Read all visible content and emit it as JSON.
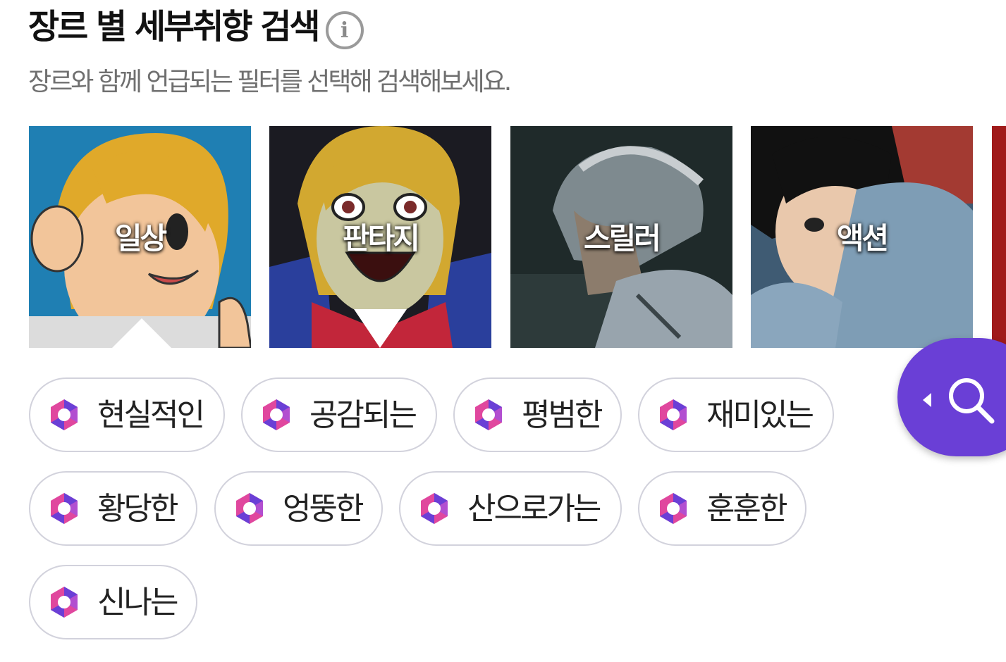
{
  "header": {
    "title": "장르 별 세부취향 검색",
    "info_icon": "info-icon",
    "info_glyph": "i",
    "subtitle": "장르와 함께 언급되는 필터를 선택해 검색해보세요."
  },
  "genres": [
    {
      "label": "일상",
      "selected": true
    },
    {
      "label": "판타지",
      "selected": false
    },
    {
      "label": "스릴러",
      "selected": false
    },
    {
      "label": "액션",
      "selected": false
    }
  ],
  "filters": [
    {
      "label": "현실적인"
    },
    {
      "label": "공감되는"
    },
    {
      "label": "평범한"
    },
    {
      "label": "재미있는"
    },
    {
      "label": "황당한"
    },
    {
      "label": "엉뚱한"
    },
    {
      "label": "산으로가는"
    },
    {
      "label": "훈훈한"
    },
    {
      "label": "신나는"
    }
  ],
  "fab": {
    "icon": "search-icon",
    "color": "#6a3fd6"
  },
  "colors": {
    "chip_border": "#d2d2dc",
    "accent_purple": "#6a3fd6",
    "accent_pink": "#e0479e"
  }
}
